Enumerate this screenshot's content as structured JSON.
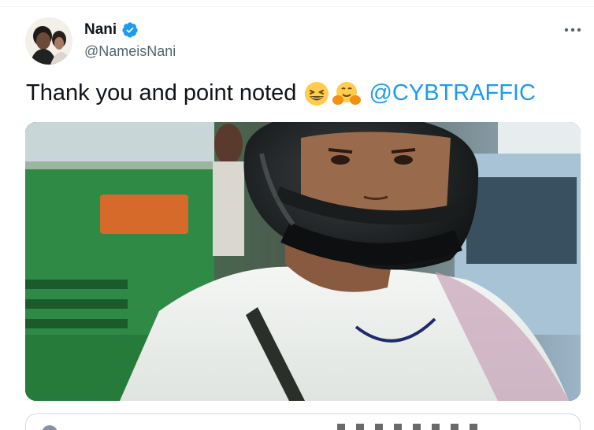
{
  "user": {
    "display_name": "Nani",
    "handle": "@NameisNani",
    "verified": true
  },
  "tweet": {
    "text": "Thank you and point noted",
    "emojis": [
      "grinning-squinting-face",
      "hugging-face"
    ],
    "mention": "@CYBTRAFFIC"
  },
  "colors": {
    "text_primary": "#0f1419",
    "text_secondary": "#536471",
    "accent": "#1d9bf0",
    "border": "#cfd9de"
  },
  "icons": {
    "verified": "verified-badge-icon",
    "more": "more-options-icon"
  }
}
